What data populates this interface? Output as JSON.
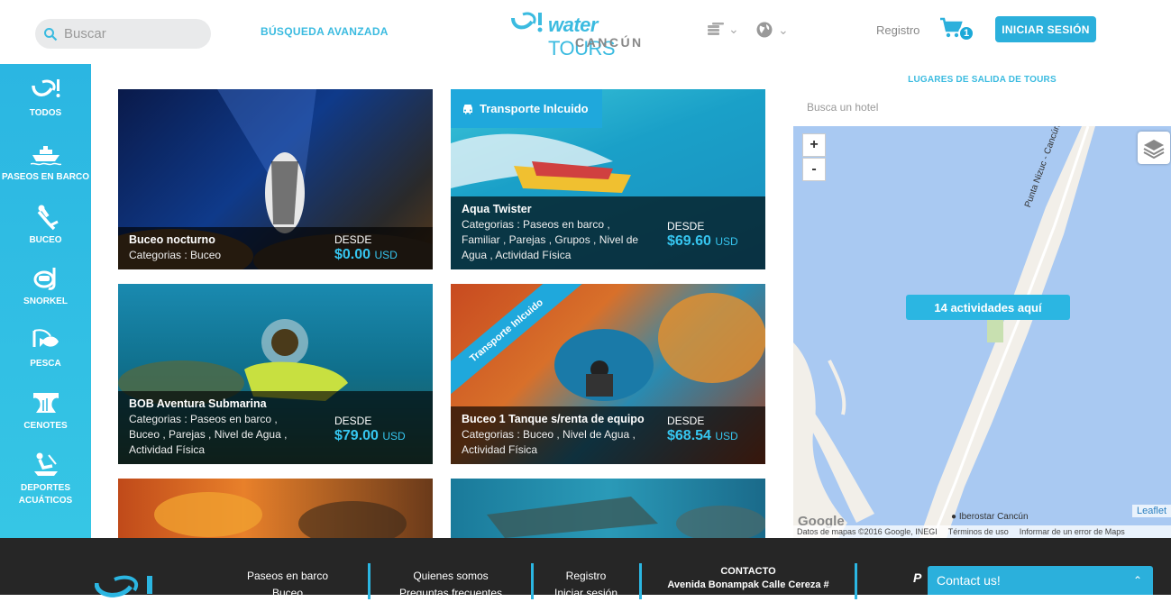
{
  "header": {
    "search_placeholder": "Buscar",
    "advanced_search": "BÚSQUEDA AVANZADA",
    "logo_main_italic": "W!",
    "logo_water": "water",
    "logo_tours": "TOURS",
    "logo_sub": "CANCÚN",
    "register": "Registro",
    "cart_count": "1",
    "login": "INICIAR SESIÓN"
  },
  "sidebar": {
    "items": [
      {
        "label": "TODOS",
        "icon": "logo-icon"
      },
      {
        "label": "PASEOS EN BARCO",
        "icon": "boat-icon"
      },
      {
        "label": "BUCEO",
        "icon": "diver-icon"
      },
      {
        "label": "SNORKEL",
        "icon": "snorkel-icon"
      },
      {
        "label": "PESCA",
        "icon": "fishing-icon"
      },
      {
        "label": "CENOTES",
        "icon": "cenote-icon"
      },
      {
        "label": "DEPORTES ACUÁTICOS",
        "icon": "watersports-icon"
      }
    ]
  },
  "cards": [
    {
      "name": "Buceo nocturno",
      "categories": "Categorias : Buceo",
      "desde": "DESDE",
      "price": "$0.00",
      "currency": "USD"
    },
    {
      "name": "Aqua Twister",
      "categories": "Categorias : Paseos en barco , Familiar , Parejas , Grupos , Nivel de Agua , Actividad Física",
      "desde": "DESDE",
      "price": "$69.60",
      "currency": "USD",
      "tag": "Transporte Inlcuido"
    },
    {
      "name": "BOB Aventura Submarina",
      "categories": "Categorias : Paseos en barco , Buceo , Parejas , Nivel de Agua , Actividad Física",
      "desde": "DESDE",
      "price": "$79.00",
      "currency": "USD"
    },
    {
      "name": "Buceo 1 Tanque s/renta de equipo",
      "categories": "Categorias : Buceo , Nivel de Agua , Actividad Física",
      "desde": "DESDE",
      "price": "$68.54",
      "currency": "USD",
      "ribbon": "Transporte Inlcuido"
    }
  ],
  "map": {
    "title": "LUGARES DE SALIDA DE TOURS",
    "search_placeholder": "Busca un hotel",
    "zoom_in": "+",
    "zoom_out": "-",
    "cluster_label": "14 actividades aquí",
    "road_label": "Punta Nizuc - Cancún",
    "hotel_label": "Iberostar Cancún",
    "leaflet": "Leaflet",
    "google": "Google",
    "copyright": "Datos de mapas ©2016 Google, INEGI",
    "terms": "Términos de uso",
    "report": "Informar de un error de Maps"
  },
  "footer": {
    "col1": [
      "Paseos en barco",
      "Buceo"
    ],
    "col2": [
      "Quienes somos",
      "Preguntas frecuentes"
    ],
    "col3": [
      "Registro",
      "Iniciar sesión"
    ],
    "contact_title": "CONTACTO",
    "contact_address": "Avenida Bonampak Calle Cereza #",
    "contact_button": "Contact us!"
  }
}
